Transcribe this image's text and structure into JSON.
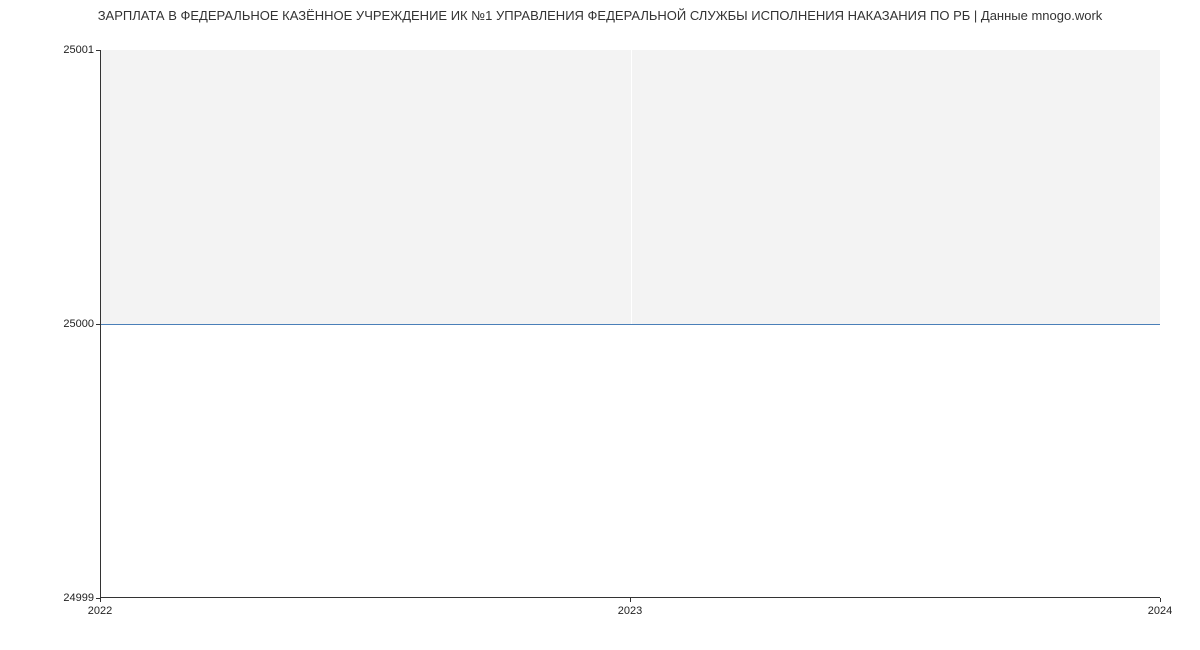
{
  "chart_data": {
    "type": "line",
    "title": "ЗАРПЛАТА В ФЕДЕРАЛЬНОЕ КАЗЁННОЕ УЧРЕЖДЕНИЕ ИК №1 УПРАВЛЕНИЯ ФЕДЕРАЛЬНОЙ СЛУЖБЫ ИСПОЛНЕНИЯ НАКАЗАНИЯ ПО РБ | Данные mnogo.work",
    "xlabel": "",
    "ylabel": "",
    "x": [
      "2022",
      "2023",
      "2024"
    ],
    "x_ticks": [
      "2022",
      "2023",
      "2024"
    ],
    "y_ticks": [
      "24999",
      "25000",
      "25001"
    ],
    "ylim": [
      24999,
      25001
    ],
    "series": [
      {
        "name": "salary",
        "values": [
          25000,
          25000,
          25000
        ],
        "color": "#4a7fb8"
      }
    ]
  }
}
